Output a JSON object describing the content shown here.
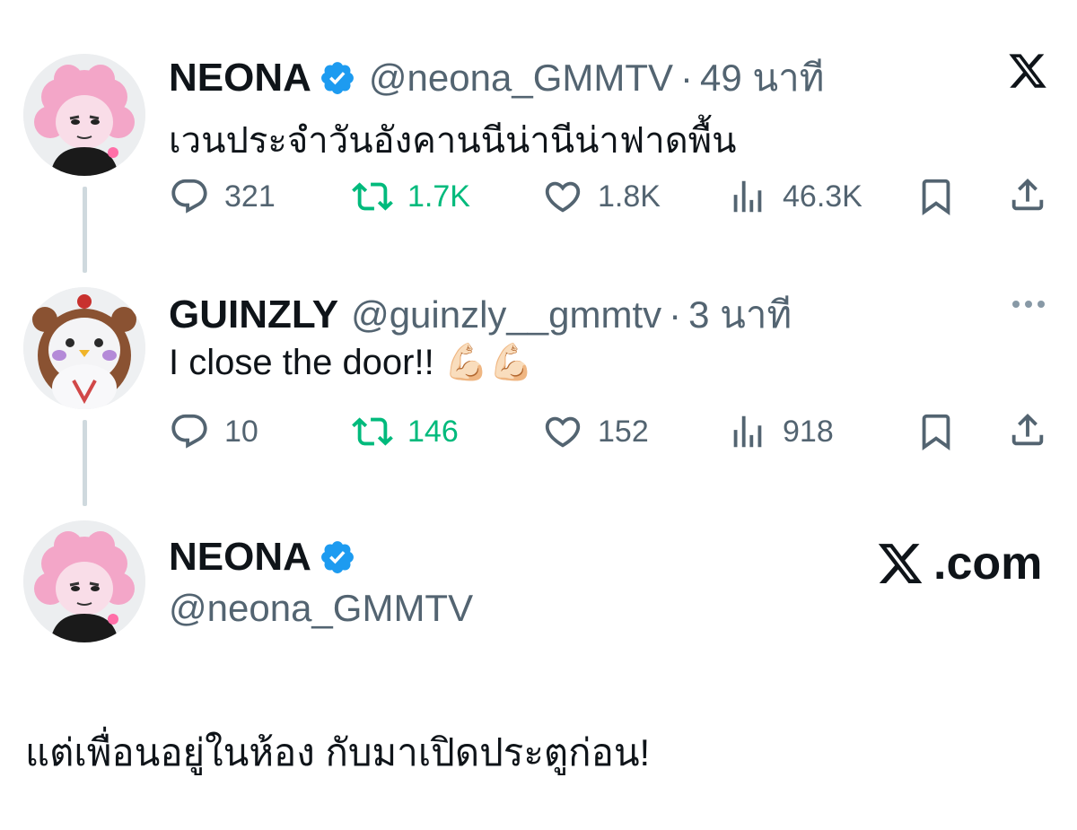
{
  "colors": {
    "text": "#0f1419",
    "muted": "#536471",
    "retweet": "#00ba7c",
    "verified": "#1d9bf0",
    "thread_line": "#cfd9de"
  },
  "tweet1": {
    "name": "NEONA",
    "handle": "@neona_GMMTV",
    "separator": "·",
    "time": "49 นาที",
    "text": "เวนประจำวันอังคานนีน่านีน่าฟาดพื้น",
    "replies": "321",
    "retweets": "1.7K",
    "likes": "1.8K",
    "views": "46.3K",
    "verified": true,
    "avatar": "pink-flower-plush-avatar"
  },
  "tweet2": {
    "name": "GUINZLY",
    "handle": "@guinzly__gmmtv",
    "separator": "·",
    "time": "3 นาที",
    "text": "I close the door!! 💪🏻💪🏻",
    "replies": "10",
    "retweets": "146",
    "likes": "152",
    "views": "918",
    "avatar": "brown-bear-penguin-plush-avatar"
  },
  "tweet3": {
    "name": "NEONA",
    "handle": "@neona_GMMTV",
    "verified": true,
    "text": "แต่เพื่อนอยู่ในห้อง กับมาเปิดประตูก่อน!",
    "brand": ".com",
    "avatar": "pink-flower-plush-avatar"
  },
  "icons": {
    "reply": "reply-icon",
    "retweet": "retweet-icon",
    "like": "heart-icon",
    "views": "views-icon",
    "bookmark": "bookmark-icon",
    "share": "share-icon",
    "more": "more-icon",
    "logo": "x-logo-icon"
  }
}
